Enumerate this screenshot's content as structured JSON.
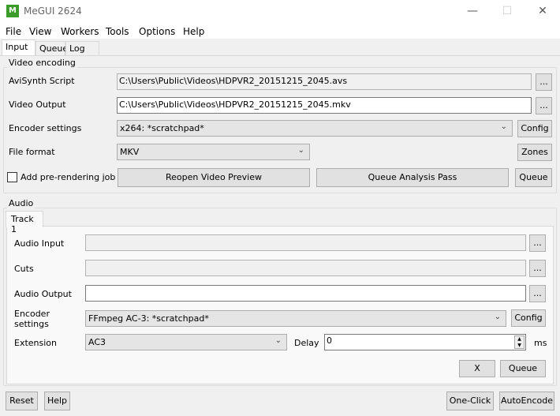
{
  "window": {
    "title": "MeGUI 2624",
    "icon_text": "M",
    "min": "—",
    "max": "☐",
    "close": "✕"
  },
  "menu": [
    "File",
    "View",
    "Workers",
    "Tools",
    "Options",
    "Help"
  ],
  "tabs": [
    "Input",
    "Queue",
    "Log"
  ],
  "video": {
    "group_label": "Video encoding",
    "avisynth_label": "AviSynth Script",
    "avisynth_value": "C:\\Users\\Public\\Videos\\HDPVR2_20151215_2045.avs",
    "output_label": "Video Output",
    "output_value": "C:\\Users\\Public\\Videos\\HDPVR2_20151215_2045.mkv",
    "encoder_label": "Encoder settings",
    "encoder_value": "x264: *scratchpad*",
    "format_label": "File format",
    "format_value": "MKV",
    "browse": "...",
    "config": "Config",
    "zones": "Zones",
    "prerender_label": "Add pre-rendering job",
    "prerender_checked": false,
    "reopen": "Reopen Video Preview",
    "analysis": "Queue Analysis Pass",
    "queue": "Queue"
  },
  "audio": {
    "group_label": "Audio",
    "track_tab": "Track 1",
    "input_label": "Audio Input",
    "input_value": "",
    "cuts_label": "Cuts",
    "cuts_value": "",
    "output_label": "Audio Output",
    "output_value": "",
    "encoder_label_1": "Encoder",
    "encoder_label_2": "settings",
    "encoder_value": "FFmpeg AC-3: *scratchpad*",
    "extension_label": "Extension",
    "extension_value": "AC3",
    "delay_label": "Delay",
    "delay_value": "0",
    "delay_unit": "ms",
    "browse": "...",
    "config": "Config",
    "remove": "X",
    "queue": "Queue"
  },
  "footer": {
    "reset": "Reset",
    "help": "Help",
    "oneclick": "One-Click",
    "autoencode": "AutoEncode"
  }
}
